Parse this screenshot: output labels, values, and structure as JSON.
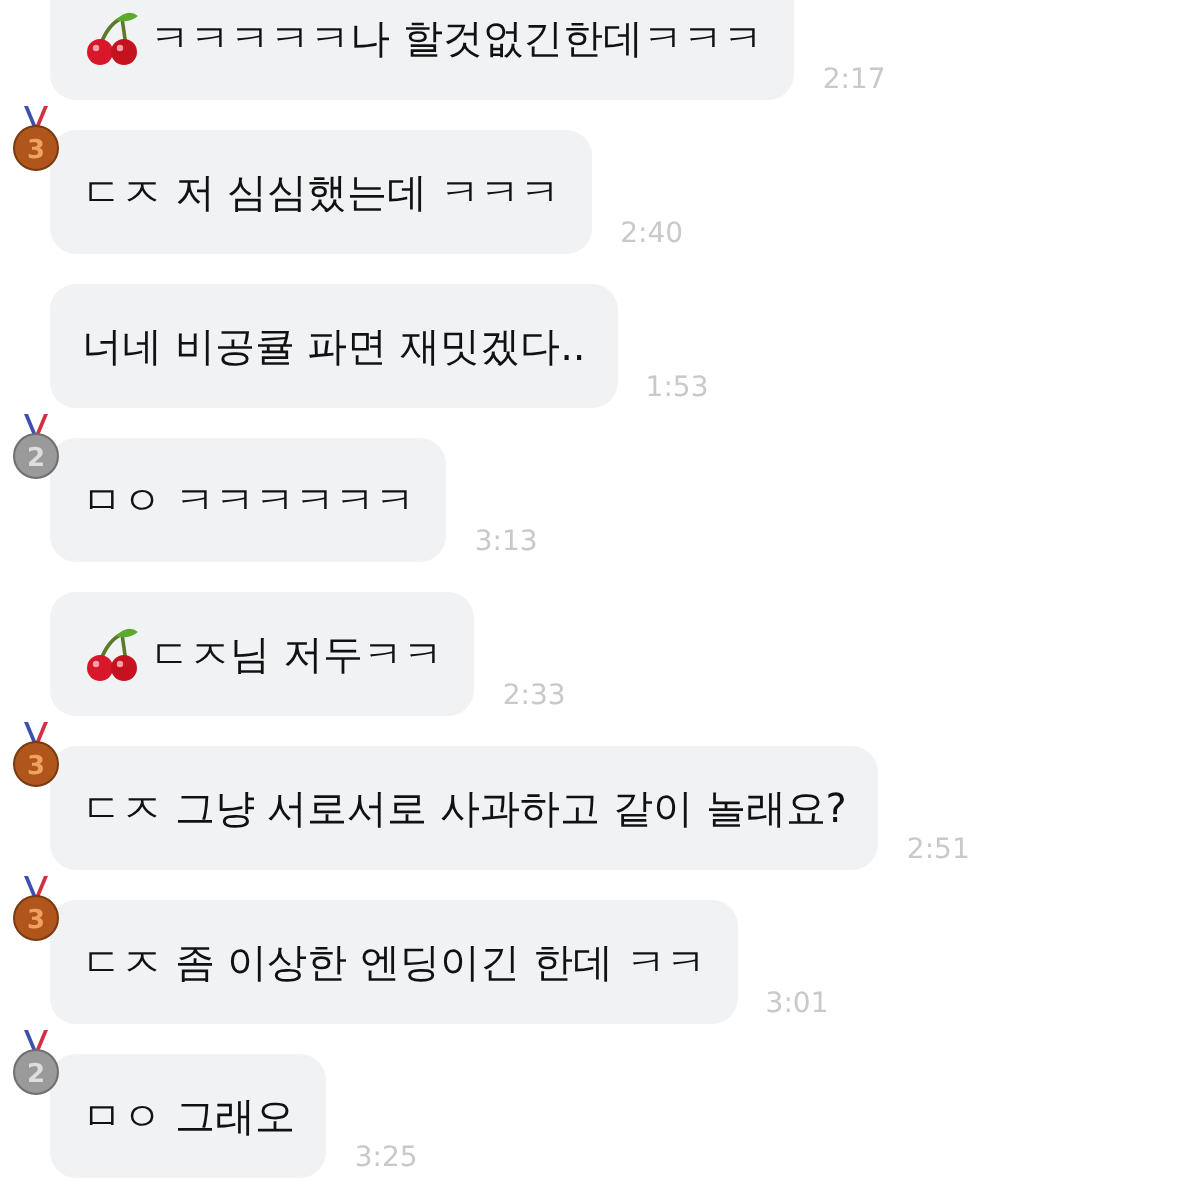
{
  "messages": [
    {
      "kind": "cherry",
      "text": "ㅋㅋㅋㅋㅋ나 할것없긴한데ㅋㅋㅋ",
      "time": "2:17"
    },
    {
      "kind": "medal",
      "medal": {
        "kind": "bronze",
        "label": "3"
      },
      "text": "ㄷㅈ 저 심심했는데 ㅋㅋㅋ",
      "time": "2:40"
    },
    {
      "kind": "plain",
      "text": "너네 비공큘 파면 재밋겠다..",
      "time": "1:53"
    },
    {
      "kind": "medal",
      "medal": {
        "kind": "silver",
        "label": "2"
      },
      "text": "ㅁㅇ ㅋㅋㅋㅋㅋㅋ",
      "time": "3:13"
    },
    {
      "kind": "cherry",
      "text": "ㄷㅈ님 저두ㅋㅋ",
      "time": "2:33"
    },
    {
      "kind": "medal",
      "medal": {
        "kind": "bronze",
        "label": "3"
      },
      "text": "ㄷㅈ 그냥 서로서로 사과하고 같이 놀래요?",
      "time": "2:51"
    },
    {
      "kind": "medal",
      "medal": {
        "kind": "bronze",
        "label": "3"
      },
      "text": "ㄷㅈ 좀 이상한 엔딩이긴 한데 ㅋㅋ",
      "time": "3:01"
    },
    {
      "kind": "medal",
      "medal": {
        "kind": "silver",
        "label": "2"
      },
      "text": "ㅁㅇ 그래오",
      "time": "3:25"
    }
  ]
}
